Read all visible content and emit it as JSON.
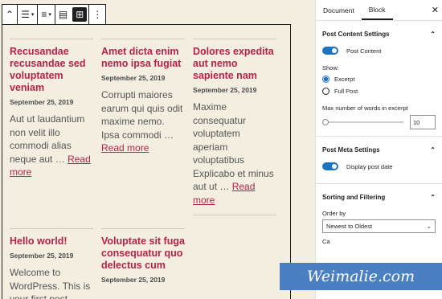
{
  "toolbar": {
    "items": [
      "chevron-up-icon",
      "list-view-icon",
      "align-icon",
      "list-layout-icon",
      "grid-layout-icon",
      "more-options-icon"
    ],
    "glyphs": {
      "up": "⌃",
      "list": "☰",
      "align": "≡",
      "caret": "▾",
      "listview": "▤",
      "grid": "⊞",
      "more": "⋮"
    }
  },
  "posts": [
    {
      "title": "Recusandae recusandae sed voluptatem veniam",
      "date": "September 25, 2019",
      "excerpt": "Aut ut laudantium non velit illo commodi alias neque aut …",
      "more": "Read more"
    },
    {
      "title": "Amet dicta enim nemo ipsa fugiat",
      "date": "September 25, 2019",
      "excerpt": "Corrupti maiores earum qui quis odit maxime nemo. Ipsa commodi …",
      "more": "Read more"
    },
    {
      "title": "Dolores expedita aut nemo sapiente nam",
      "date": "September 25, 2019",
      "excerpt": "Maxime consequatur voluptatem aperiam voluptatibus Explicabo et minus aut ut …",
      "more": "Read more"
    },
    {
      "title": "Hello world!",
      "date": "September 25, 2019",
      "excerpt": "Welcome to WordPress. This is your first post",
      "more": ""
    },
    {
      "title": "Voluptate sit fuga consequatur quo delectus cum",
      "date": "September 25, 2019",
      "excerpt": "",
      "more": ""
    }
  ],
  "sidebar": {
    "tabs": [
      "Document",
      "Block"
    ],
    "close": "✕",
    "chevron_up": "⌃",
    "chevron_down": "⌄",
    "post_content": {
      "heading": "Post Content Settings",
      "toggle_label": "Post Content",
      "show_label": "Show:",
      "options": [
        "Excerpt",
        "Full Post"
      ],
      "selected": "Excerpt",
      "words_label": "Max number of words in excerpt",
      "words_value": "10"
    },
    "post_meta": {
      "heading": "Post Meta Settings",
      "toggle_label": "Display post date"
    },
    "sorting": {
      "heading": "Sorting and Filtering",
      "order_label": "Order by",
      "order_value": "Newest to Oldest",
      "partial_label": "Ca"
    }
  },
  "watermark": "Weimalie.com"
}
